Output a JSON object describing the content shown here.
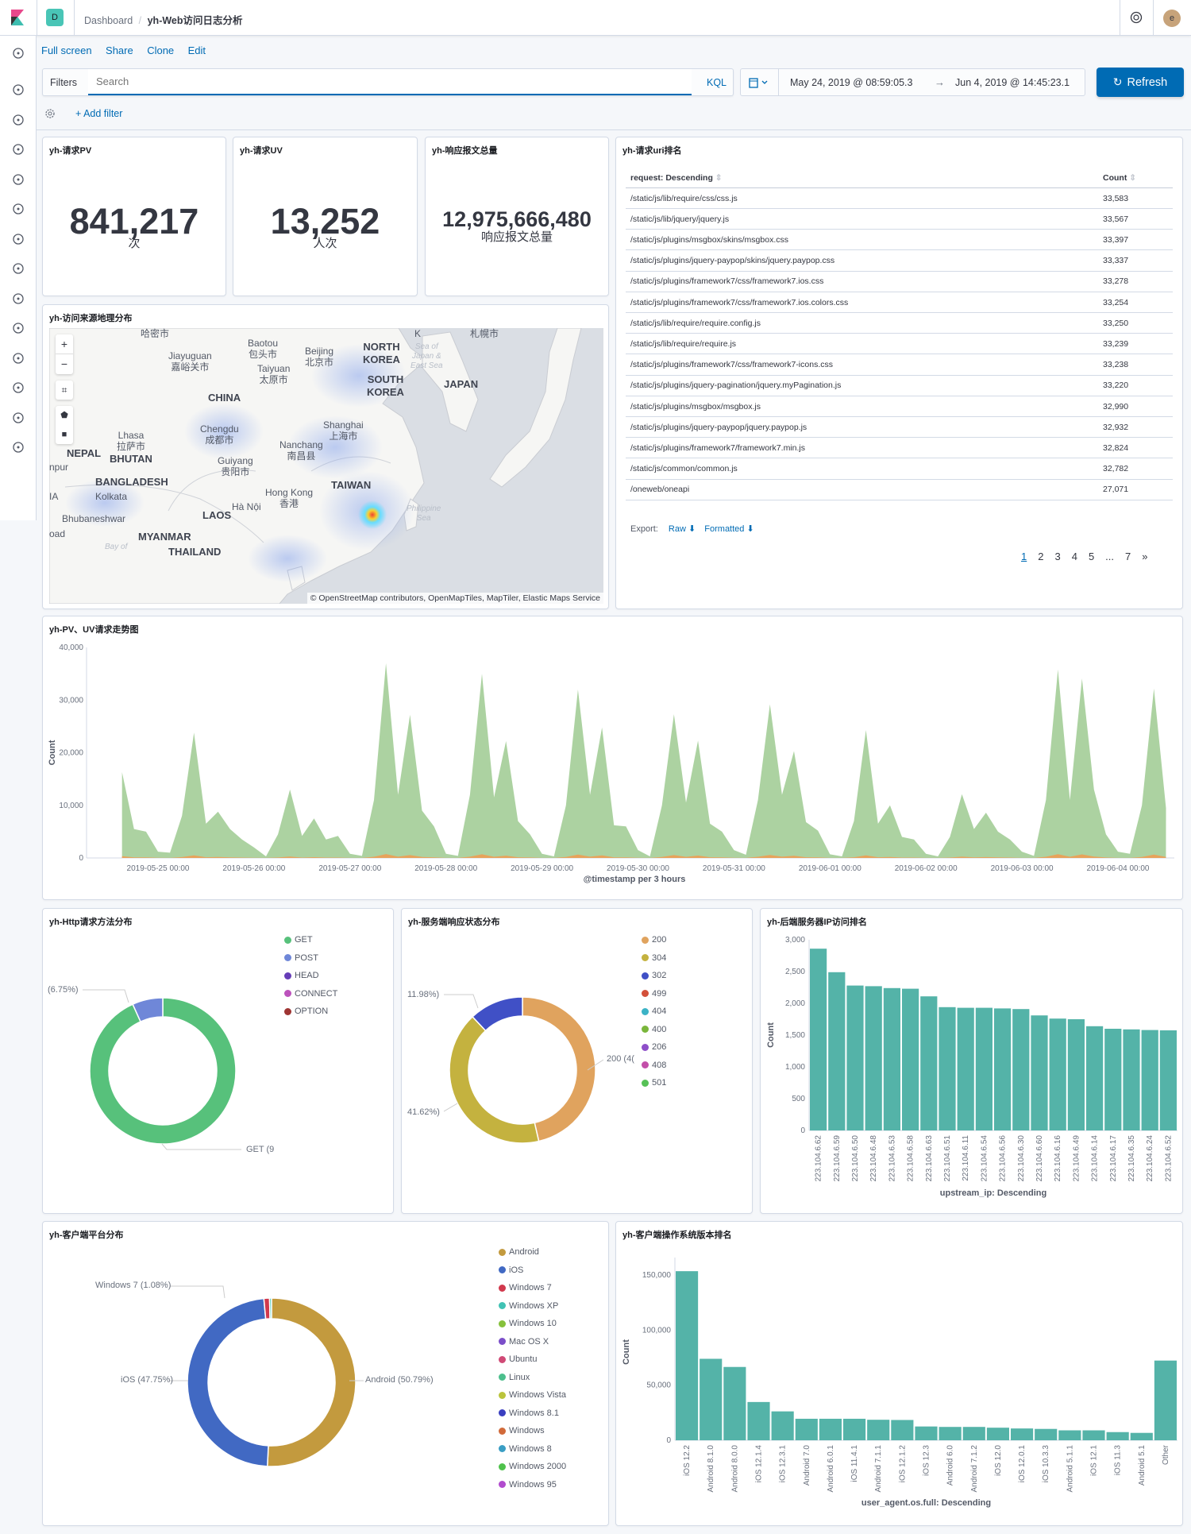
{
  "header": {
    "logo": "K",
    "space_initial": "D",
    "breadcrumb_root": "Dashboard",
    "breadcrumb_current": "yh-Web访问日志分析",
    "avatar_initial": "e"
  },
  "sidebar": {
    "icons": [
      "recent-icon",
      "discover-icon",
      "visualize-icon",
      "dashboard-icon",
      "canvas-icon",
      "maps-icon",
      "ml-icon",
      "infrastructure-icon",
      "logs-icon",
      "apm-icon",
      "uptime-icon",
      "dev-tools-icon",
      "monitoring-icon",
      "management-icon"
    ]
  },
  "toolbar": {
    "full_screen": "Full screen",
    "share": "Share",
    "clone": "Clone",
    "edit": "Edit"
  },
  "query": {
    "filters_label": "Filters",
    "search_placeholder": "Search",
    "kql": "KQL",
    "time_from": "May 24, 2019 @ 08:59:05.3",
    "arrow": "→",
    "time_to": "Jun 4, 2019 @ 14:45:23.1",
    "refresh": "Refresh",
    "add_filter": "+ Add filter"
  },
  "colors": {
    "accent": "#006bb4",
    "bar": "#54b3a8",
    "pv": "#a3cd97",
    "uv": "#e7a35b"
  },
  "metrics": [
    {
      "title": "yh-请求PV",
      "value": "841,217",
      "label": "次"
    },
    {
      "title": "yh-请求UV",
      "value": "13,252",
      "label": "人次"
    },
    {
      "title": "yh-响应报文总量",
      "value": "12,975,666,480",
      "label": "响应报文总量"
    }
  ],
  "uri_table": {
    "title": "yh-请求uri排名",
    "col_request": "request: Descending",
    "col_count": "Count",
    "rows": [
      {
        "request": "/static/js/lib/require/css/css.js",
        "count": "33,583"
      },
      {
        "request": "/static/js/lib/jquery/jquery.js",
        "count": "33,567"
      },
      {
        "request": "/static/js/plugins/msgbox/skins/msgbox.css",
        "count": "33,397"
      },
      {
        "request": "/static/js/plugins/jquery-paypop/skins/jquery.paypop.css",
        "count": "33,337"
      },
      {
        "request": "/static/js/plugins/framework7/css/framework7.ios.css",
        "count": "33,278"
      },
      {
        "request": "/static/js/plugins/framework7/css/framework7.ios.colors.css",
        "count": "33,254"
      },
      {
        "request": "/static/js/lib/require/require.config.js",
        "count": "33,250"
      },
      {
        "request": "/static/js/lib/require/require.js",
        "count": "33,239"
      },
      {
        "request": "/static/js/plugins/framework7/css/framework7-icons.css",
        "count": "33,238"
      },
      {
        "request": "/static/js/plugins/jquery-pagination/jquery.myPagination.js",
        "count": "33,220"
      },
      {
        "request": "/static/js/plugins/msgbox/msgbox.js",
        "count": "32,990"
      },
      {
        "request": "/static/js/plugins/jquery-paypop/jquery.paypop.js",
        "count": "32,932"
      },
      {
        "request": "/static/js/plugins/framework7/framework7.min.js",
        "count": "32,824"
      },
      {
        "request": "/static/js/common/common.js",
        "count": "32,782"
      },
      {
        "request": "/oneweb/oneapi",
        "count": "27,071"
      }
    ],
    "export_label": "Export:",
    "export_raw": "Raw",
    "export_formatted": "Formatted",
    "pages": [
      "1",
      "2",
      "3",
      "4",
      "5",
      "...",
      "7",
      "»"
    ],
    "current_page": "1"
  },
  "map": {
    "title": "yh-访问来源地理分布",
    "attribution": "© OpenStreetMap contributors, OpenMapTiles, MapTiler, Elastic Maps Service",
    "labels": [
      "哈密市",
      "Jiayuguan\n嘉峪关市",
      "Baotou\n包头市",
      "Beijing\n北京市",
      "Taiyuan\n太原市",
      "NORTH\nKOREA",
      "SOUTH\nKOREA",
      "JAPAN",
      "CHINA",
      "Shanghai\n上海市",
      "Chengdu\n成都市",
      "Lhasa\n拉萨市",
      "Nanchang\n南昌县",
      "NEPAL",
      "BHUTAN",
      "Guiyang\n贵阳市",
      "BANGLADESH",
      "Kolkata",
      "TAIWAN",
      "Hong Kong\n香港",
      "Hà Nội",
      "LAOS",
      "Bhubaneshwar",
      "MYANMAR",
      "THAILAND",
      "Sea of\nJapan &\nEast Sea",
      "Philippine\nSea",
      "Bay of",
      "札幌市",
      "npur",
      "oad",
      "IA",
      "K"
    ],
    "controls": {
      "zoom_in": "+",
      "zoom_out": "−"
    }
  },
  "chart_data": [
    {
      "type": "area",
      "title": "yh-PV、UV请求走势图",
      "xlabel": "@timestamp per 3 hours",
      "ylabel": "Count",
      "ylim": [
        0,
        40000
      ],
      "yticks": [
        "0",
        "10,000",
        "20,000",
        "30,000",
        "40,000"
      ],
      "xticks": [
        "2019-05-25 00:00",
        "2019-05-26 00:00",
        "2019-05-27 00:00",
        "2019-05-28 00:00",
        "2019-05-29 00:00",
        "2019-05-30 00:00",
        "2019-05-31 00:00",
        "2019-06-01 00:00",
        "2019-06-02 00:00",
        "2019-06-03 00:00",
        "2019-06-04 00:00"
      ],
      "x": [
        "2019-05-24 15:00",
        "2019-05-24 18:00",
        "2019-05-24 21:00",
        "2019-05-25 00:00",
        "2019-05-25 03:00",
        "2019-05-25 06:00",
        "2019-05-25 09:00",
        "2019-05-25 12:00",
        "2019-05-25 15:00",
        "2019-05-25 18:00",
        "2019-05-25 21:00",
        "2019-05-26 00:00",
        "2019-05-26 03:00",
        "2019-05-26 06:00",
        "2019-05-26 09:00",
        "2019-05-26 12:00",
        "2019-05-26 15:00",
        "2019-05-26 18:00",
        "2019-05-26 21:00",
        "2019-05-27 00:00",
        "2019-05-27 03:00",
        "2019-05-27 06:00",
        "2019-05-27 09:00",
        "2019-05-27 12:00",
        "2019-05-27 15:00",
        "2019-05-27 18:00",
        "2019-05-27 21:00",
        "2019-05-28 00:00",
        "2019-05-28 03:00",
        "2019-05-28 06:00",
        "2019-05-28 09:00",
        "2019-05-28 12:00",
        "2019-05-28 15:00",
        "2019-05-28 18:00",
        "2019-05-28 21:00",
        "2019-05-29 00:00",
        "2019-05-29 03:00",
        "2019-05-29 06:00",
        "2019-05-29 09:00",
        "2019-05-29 12:00",
        "2019-05-29 15:00",
        "2019-05-29 18:00",
        "2019-05-29 21:00",
        "2019-05-30 00:00",
        "2019-05-30 03:00",
        "2019-05-30 06:00",
        "2019-05-30 09:00",
        "2019-05-30 12:00",
        "2019-05-30 15:00",
        "2019-05-30 18:00",
        "2019-05-30 21:00",
        "2019-05-31 00:00",
        "2019-05-31 03:00",
        "2019-05-31 06:00",
        "2019-05-31 09:00",
        "2019-05-31 12:00",
        "2019-05-31 15:00",
        "2019-05-31 18:00",
        "2019-05-31 21:00",
        "2019-06-01 00:00",
        "2019-06-01 03:00",
        "2019-06-01 06:00",
        "2019-06-01 09:00",
        "2019-06-01 12:00",
        "2019-06-01 15:00",
        "2019-06-01 18:00",
        "2019-06-01 21:00",
        "2019-06-02 00:00",
        "2019-06-02 03:00",
        "2019-06-02 06:00",
        "2019-06-02 09:00",
        "2019-06-02 12:00",
        "2019-06-02 15:00",
        "2019-06-02 18:00",
        "2019-06-02 21:00",
        "2019-06-03 00:00",
        "2019-06-03 03:00",
        "2019-06-03 06:00",
        "2019-06-03 09:00",
        "2019-06-03 12:00",
        "2019-06-03 15:00",
        "2019-06-03 18:00",
        "2019-06-03 21:00",
        "2019-06-04 00:00",
        "2019-06-04 03:00",
        "2019-06-04 06:00",
        "2019-06-04 09:00",
        "2019-06-04 12:00"
      ],
      "series": [
        {
          "color": "#a3cd97",
          "values": [
            16300,
            5500,
            5000,
            1200,
            1000,
            8000,
            23800,
            6500,
            8800,
            5500,
            3500,
            2000,
            300,
            4500,
            13000,
            4200,
            7500,
            3500,
            4200,
            800,
            400,
            11000,
            37000,
            12000,
            27200,
            9000,
            6000,
            800,
            400,
            12000,
            35000,
            11500,
            22200,
            7000,
            4500,
            800,
            300,
            10000,
            32000,
            12000,
            24800,
            6200,
            6000,
            1500,
            300,
            10000,
            27300,
            10500,
            22300,
            6500,
            5000,
            1500,
            600,
            11000,
            29200,
            12000,
            20300,
            6800,
            5200,
            700,
            300,
            7000,
            24300,
            6500,
            10000,
            4000,
            3500,
            800,
            300,
            4000,
            12100,
            5500,
            8600,
            5000,
            3500,
            1200,
            400,
            11000,
            35800,
            11000,
            34100,
            13000,
            4500,
            1200,
            800,
            10000,
            32200,
            9500
          ]
        },
        {
          "color": "#e7a35b",
          "values": [
            330,
            110,
            100,
            30,
            20,
            160,
            480,
            130,
            180,
            110,
            70,
            40,
            10,
            90,
            260,
            80,
            150,
            70,
            80,
            20,
            10,
            220,
            740,
            240,
            540,
            180,
            120,
            20,
            10,
            240,
            700,
            230,
            440,
            140,
            90,
            20,
            10,
            200,
            640,
            240,
            500,
            120,
            120,
            30,
            10,
            200,
            550,
            210,
            450,
            130,
            100,
            30,
            10,
            220,
            580,
            240,
            410,
            140,
            100,
            10,
            10,
            140,
            490,
            130,
            200,
            80,
            70,
            20,
            10,
            80,
            240,
            110,
            170,
            100,
            70,
            20,
            10,
            220,
            720,
            220,
            680,
            260,
            90,
            20,
            20,
            200,
            640,
            190
          ]
        }
      ]
    },
    {
      "type": "pie",
      "title": "yh-Http请求方法分布",
      "donut": true,
      "legend": [
        {
          "name": "GET",
          "color": "#57c17b"
        },
        {
          "name": "POST",
          "color": "#6f87d8"
        },
        {
          "name": "HEAD",
          "color": "#663db8"
        },
        {
          "name": "CONNECT",
          "color": "#bc52bc"
        },
        {
          "name": "OPTION",
          "color": "#9e3533"
        }
      ],
      "slices": [
        {
          "name": "GET",
          "value": 93.25,
          "color": "#57c17b"
        },
        {
          "name": "POST",
          "value": 6.75,
          "color": "#6f87d8"
        }
      ],
      "callouts": [
        "(6.75%)",
        "GET (9"
      ]
    },
    {
      "type": "pie",
      "title": "yh-服务端响应状态分布",
      "donut": true,
      "legend": [
        {
          "name": "200",
          "color": "#e0a35e"
        },
        {
          "name": "304",
          "color": "#c4b23f"
        },
        {
          "name": "302",
          "color": "#4050c6"
        },
        {
          "name": "499",
          "color": "#d3503a"
        },
        {
          "name": "404",
          "color": "#3bb3c6"
        },
        {
          "name": "400",
          "color": "#7ab63b"
        },
        {
          "name": "206",
          "color": "#8e4fc9"
        },
        {
          "name": "408",
          "color": "#c34fa9"
        },
        {
          "name": "501",
          "color": "#57c157"
        }
      ],
      "slices": [
        {
          "name": "200",
          "value": 46.4,
          "color": "#e0a35e"
        },
        {
          "name": "304",
          "value": 41.62,
          "color": "#c4b23f"
        },
        {
          "name": "302",
          "value": 11.98,
          "color": "#4050c6"
        }
      ],
      "callouts": [
        "11.98%)",
        "41.62%)",
        "200 (4("
      ]
    },
    {
      "type": "bar",
      "title": "yh-后端服务器IP访问排名",
      "xlabel": "upstream_ip: Descending",
      "ylabel": "Count",
      "ylim": [
        0,
        3000
      ],
      "yticks": [
        "0",
        "500",
        "1,000",
        "1,500",
        "2,000",
        "2,500",
        "3,000"
      ],
      "categories": [
        "223.104.6.62",
        "223.104.6.59",
        "223.104.6.50",
        "223.104.6.48",
        "223.104.6.53",
        "223.104.6.58",
        "223.104.6.63",
        "223.104.6.51",
        "223.104.6.11",
        "223.104.6.54",
        "223.104.6.56",
        "223.104.6.30",
        "223.104.6.60",
        "223.104.6.16",
        "223.104.6.49",
        "223.104.6.14",
        "223.104.6.17",
        "223.104.6.35",
        "223.104.6.24",
        "223.104.6.52"
      ],
      "values": [
        2860,
        2490,
        2280,
        2270,
        2240,
        2230,
        2110,
        1940,
        1930,
        1930,
        1920,
        1910,
        1810,
        1760,
        1750,
        1640,
        1600,
        1590,
        1580,
        1575
      ]
    },
    {
      "type": "pie",
      "title": "yh-客户端平台分布",
      "donut": true,
      "legend": [
        {
          "name": "Android",
          "color": "#c39a3e"
        },
        {
          "name": "iOS",
          "color": "#4169c3"
        },
        {
          "name": "Windows 7",
          "color": "#d1394d"
        },
        {
          "name": "Windows XP",
          "color": "#41c2b4"
        },
        {
          "name": "Windows 10",
          "color": "#86c13c"
        },
        {
          "name": "Mac OS X",
          "color": "#7b4ec9"
        },
        {
          "name": "Ubuntu",
          "color": "#d04a76"
        },
        {
          "name": "Linux",
          "color": "#4cbf8d"
        },
        {
          "name": "Windows Vista",
          "color": "#bac43c"
        },
        {
          "name": "Windows 8.1",
          "color": "#3a3fc0"
        },
        {
          "name": "Windows",
          "color": "#d16a3a"
        },
        {
          "name": "Windows 8",
          "color": "#3a9ec4"
        },
        {
          "name": "Windows 2000",
          "color": "#4fc24c"
        },
        {
          "name": "Windows 95",
          "color": "#b14cce"
        }
      ],
      "slices": [
        {
          "name": "Android",
          "value": 50.79,
          "color": "#c39a3e"
        },
        {
          "name": "iOS",
          "value": 47.75,
          "color": "#4169c3"
        },
        {
          "name": "Windows 7",
          "value": 1.08,
          "color": "#d1394d"
        },
        {
          "name": "Other",
          "value": 0.38,
          "color": "#41c2b4"
        }
      ],
      "callouts": [
        "Windows 7 (1.08%)",
        "iOS (47.75%)",
        "Android (50.79%)"
      ]
    },
    {
      "type": "bar",
      "title": "yh-客户端操作系统版本排名",
      "xlabel": "user_agent.os.full: Descending",
      "ylabel": "Count",
      "ylim": [
        0,
        160000
      ],
      "yticks": [
        "0",
        "50,000",
        "100,000",
        "150,000"
      ],
      "categories": [
        "iOS 12.2",
        "Android 8.1.0",
        "Android 8.0.0",
        "iOS 12.1.4",
        "iOS 12.3.1",
        "Android 7.0",
        "Android 6.0.1",
        "iOS 11.4.1",
        "Android 7.1.1",
        "iOS 12.1.2",
        "iOS 12.3",
        "Android 6.0",
        "Android 7.1.2",
        "iOS 12.0",
        "iOS 12.0.1",
        "iOS 10.3.3",
        "Android 5.1.1",
        "iOS 12.1",
        "iOS 11.3",
        "Android 5.1",
        "Other"
      ],
      "values": [
        153400,
        73900,
        66500,
        34700,
        26200,
        19500,
        19500,
        19500,
        18600,
        18400,
        12500,
        12100,
        12100,
        11400,
        10700,
        10300,
        9000,
        9000,
        7400,
        6700,
        72300
      ]
    }
  ]
}
